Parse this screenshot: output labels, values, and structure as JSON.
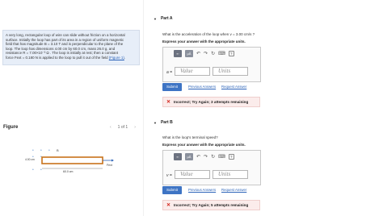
{
  "problem": {
    "text_lines": [
      "A very long, rectangular loop of wire can slide without friction on a horizontal",
      "surface. Initially the loop has part of its area in a region of uniform magnetic",
      "field that has magnitude B = 3.10  T and is perpendicular to the plane of the",
      "loop. The loop has dimensions 4.00 cm by 60.0 cm, mass 26.0  g, and",
      "resistance R = 7.00×10⁻³  Ω . The loop is initially at rest; then a constant",
      "force Fext = 0.180 N is applied to the loop to pull it out of the field "
    ],
    "figure_link": "(Figure 1)",
    "period": "."
  },
  "figure": {
    "title": "Figure",
    "prev_arrow": "‹",
    "pager": "1 of 1",
    "next_arrow": "›",
    "label_height": "4.00 cm",
    "label_length": "60.0 cm",
    "label_force": "Fext",
    "label_field": "B"
  },
  "partA": {
    "caret": "▼",
    "title": "Part A",
    "question": "What is the acceleration of the loop when v = 3.00 cm/s ?",
    "instruction": "Express your answer with the appropriate units.",
    "var_label": "a =",
    "value_placeholder": "Value",
    "units_placeholder": "Units",
    "submit": "Submit",
    "previous_answers": "Previous Answers",
    "request_answer": "Request Answer",
    "feedback": "Incorrect; Try Again; 3 attempts remaining"
  },
  "partB": {
    "caret": "▼",
    "title": "Part B",
    "question": "What is the loop's terminal speed?",
    "instruction": "Express your answer with the appropriate units.",
    "var_label": "v =",
    "value_placeholder": "Value",
    "units_placeholder": "Units",
    "submit": "Submit",
    "previous_answers": "Previous Answers",
    "request_answer": "Request Answer",
    "feedback": "Incorrect; Try Again; 5 attempts remaining"
  },
  "toolbar": {
    "template_label": "▪▫",
    "units_label": "μÅ",
    "undo_icon": "↶",
    "redo_icon": "↷",
    "reset_icon": "↻",
    "keyboard_icon": "⌨",
    "help_icon": "?"
  },
  "colors": {
    "accent": "#3e74c4",
    "link": "#2a62b8",
    "error": "#d3241a",
    "problem_bg": "#e7eef8"
  }
}
